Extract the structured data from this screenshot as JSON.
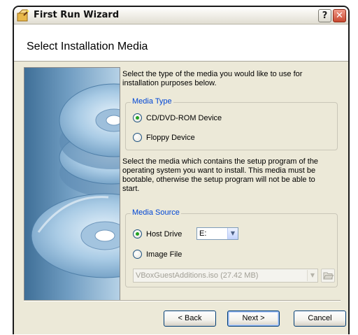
{
  "window": {
    "title": "First Run Wizard",
    "help_label": "?",
    "close_label": "✕",
    "header_title": "Select Installation Media"
  },
  "intro_text": "Select the type of the media you would like to use for installation purposes below.",
  "media_type": {
    "label": "Media Type",
    "options": [
      {
        "label": "CD/DVD-ROM Device",
        "selected": true
      },
      {
        "label": "Floppy Device",
        "selected": false
      }
    ]
  },
  "media_text": "Select the media which contains the setup program of the operating system you want to install. This media must be bootable, otherwise the setup program will not be able to start.",
  "media_source": {
    "label": "Media Source",
    "host_drive_label": "Host Drive",
    "host_drive_value": "E:",
    "image_file_label": "Image File",
    "image_file_value": "VBoxGuestAdditions.iso (27.42 MB)"
  },
  "buttons": {
    "back": "< Back",
    "next": "Next >",
    "cancel": "Cancel"
  },
  "colors": {
    "window_bg": "#ece9d8",
    "group_label": "#0046d5",
    "radio_selected": "#21a121"
  },
  "icons": {
    "title_icon": "wizard-icon",
    "image_folder": "folder-open-icon",
    "dropdown": "chevron-down-icon"
  }
}
